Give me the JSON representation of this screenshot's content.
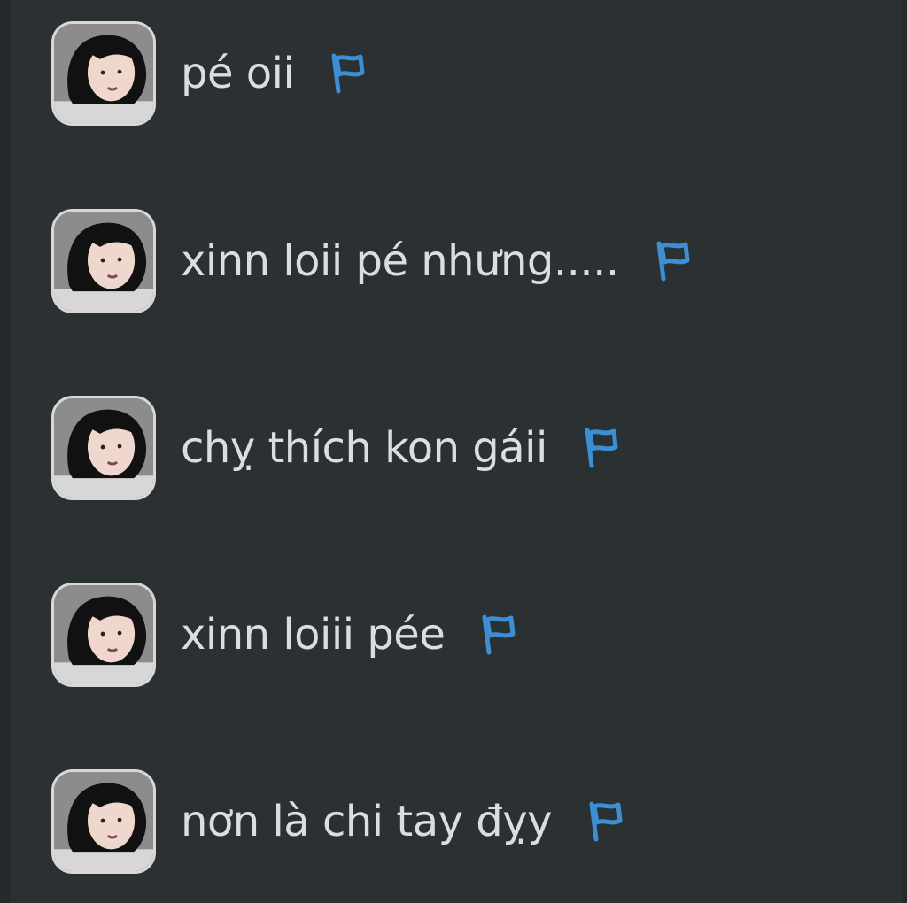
{
  "chat": {
    "messages": [
      {
        "text": "pé oii",
        "avatar_icon": "profile-photo-avatar",
        "action_icon": "flag-icon"
      },
      {
        "text": "xinn loii pé nhưng.....",
        "avatar_icon": "profile-photo-avatar",
        "action_icon": "flag-icon"
      },
      {
        "text": "chỵ thích kon gáii",
        "avatar_icon": "profile-photo-avatar",
        "action_icon": "flag-icon"
      },
      {
        "text": "xinn loiii pée",
        "avatar_icon": "profile-photo-avatar",
        "action_icon": "flag-icon"
      },
      {
        "text": "nơn là chi tay đỵy",
        "avatar_icon": "profile-photo-avatar",
        "action_icon": "flag-icon"
      }
    ]
  },
  "colors": {
    "background": "#2b3033",
    "text": "#d9dfe1",
    "flag": "#3d8fd4",
    "avatar_border": "#d8d8d8"
  }
}
